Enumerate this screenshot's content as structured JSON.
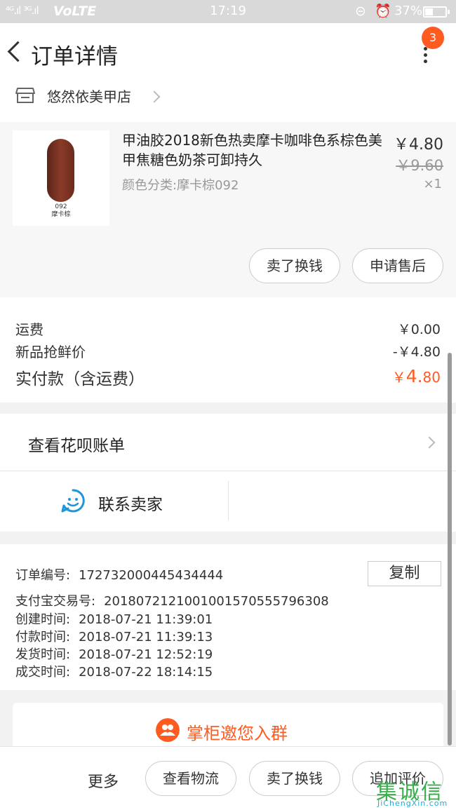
{
  "status_bar": {
    "signal": "⁴ᴳ.ıl ³ᴳ.ıl",
    "network": "VoLTE",
    "time": "17:19",
    "battery": "37%",
    "battery_level": 0.37
  },
  "header": {
    "title": "订单详情",
    "notification_count": "3"
  },
  "shop": {
    "name": "悠然依美甲店"
  },
  "product": {
    "title": "甲油胶2018新色热卖摩卡咖啡色系棕色美甲焦糖色奶茶可卸持久",
    "variant": "颜色分类:摩卡棕092",
    "price": "￥4.80",
    "original_price": "￥9.60",
    "quantity": "×1",
    "thumb_code": "092",
    "thumb_name": "摩卡棕",
    "thumb_color": "#7a3322",
    "actions": [
      "卖了换钱",
      "申请售后"
    ]
  },
  "costs": {
    "shipping_label": "运费",
    "shipping_value": "￥0.00",
    "discount_label": "新品抢鲜价",
    "discount_value": "-￥4.80",
    "total_label": "实付款（含运费）",
    "total_currency": "￥",
    "total_int": "4.",
    "total_dec": "80"
  },
  "huabei": {
    "label": "查看花呗账单"
  },
  "contact": {
    "label": "联系卖家"
  },
  "order_info": {
    "order_no_label": "订单编号:",
    "order_no": "172732000445434444",
    "copy_label": "复制",
    "alipay_label": "支付宝交易号:",
    "alipay_no": "2018072121001001570555796308",
    "created_label": "创建时间:",
    "created": "2018-07-21 11:39:01",
    "paid_label": "付款时间:",
    "paid": "2018-07-21 11:39:13",
    "shipped_label": "发货时间:",
    "shipped": "2018-07-21 12:52:19",
    "completed_label": "成交时间:",
    "completed": "2018-07-22 18:14:15"
  },
  "group": {
    "label": "掌柜邀您入群"
  },
  "bottom_bar": {
    "more": "更多",
    "buttons": [
      "查看物流",
      "卖了换钱",
      "追加评价"
    ]
  },
  "watermark": {
    "line1": "集诚信",
    "line2": "JiChengXin.com"
  },
  "colors": {
    "accent": "#ff5a1f",
    "contact_icon": "#1e96d8"
  }
}
